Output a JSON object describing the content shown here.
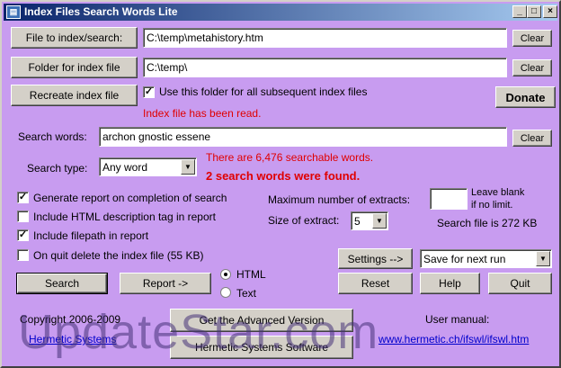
{
  "window": {
    "title": "Index Files Search Words Lite",
    "minimize": "_",
    "maximize": "□",
    "close": "×"
  },
  "file_row": {
    "button": "File to index/search:",
    "value": "C:\\temp\\metahistory.htm",
    "clear": "Clear"
  },
  "folder_row": {
    "button": "Folder for index file",
    "value": "C:\\temp\\",
    "clear": "Clear"
  },
  "recreate_button": "Recreate index file",
  "use_folder_checkbox": {
    "label": "Use this folder for all subsequent index files",
    "checked": true
  },
  "donate_button": "Donate",
  "status_message": "Index file has been read.",
  "search_words": {
    "label": "Search words:",
    "value": "archon gnostic essene",
    "clear": "Clear"
  },
  "searchable_message": "There are 6,476 searchable words.",
  "found_message": "2 search words were found.",
  "search_type": {
    "label": "Search type:",
    "value": "Any word"
  },
  "options": [
    {
      "label": "Generate report on completion of search",
      "checked": true
    },
    {
      "label": "Include HTML description tag in report",
      "checked": false
    },
    {
      "label": "Include filepath in report",
      "checked": true
    },
    {
      "label": "On quit delete the index file (55 KB)",
      "checked": false
    }
  ],
  "extracts": {
    "max_label": "Maximum number of extracts:",
    "max_value": "",
    "hint_line1": "Leave blank",
    "hint_line2": "if no limit.",
    "size_label": "Size of extract:",
    "size_value": "5"
  },
  "search_file_size": "Search file is 272 KB",
  "settings_button": "Settings -->",
  "run_select": "Save for next run",
  "search_button": "Search",
  "report_button": "Report ->",
  "format": {
    "html": "HTML",
    "text": "Text",
    "selected": "HTML"
  },
  "reset_button": "Reset",
  "help_button": "Help",
  "quit_button": "Quit",
  "footer": {
    "copyright": "Copyright 2006-2009",
    "company_link": "Hermetic Systems",
    "advanced_button": "Get the Advanced Version",
    "software_button": "Hermetic Systems Software",
    "manual_label": "User manual:",
    "manual_link": "www.hermetic.ch/ifswl/ifswl.htm"
  },
  "watermark": "UpdateStar.com"
}
